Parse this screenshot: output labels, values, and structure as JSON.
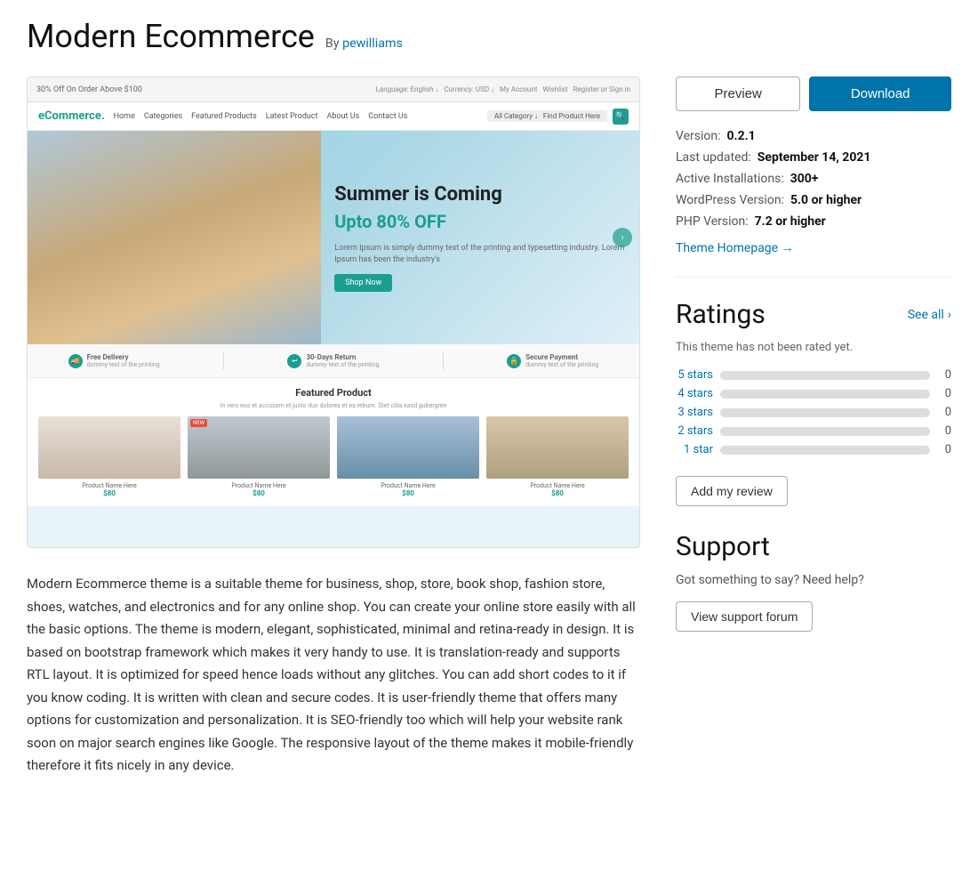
{
  "header": {
    "title": "Modern Ecommerce",
    "by_text": "By",
    "author": "pewilliams"
  },
  "screenshot_alt": "Modern Ecommerce theme screenshot",
  "fake_screenshot": {
    "topbar_text": "30% Off On Order Above $100",
    "logo": "eCommerce.",
    "nav_links": [
      "Home",
      "Categories",
      "Featured Products",
      "Latest Product",
      "About Us",
      "Contact Us"
    ],
    "hero_heading": "Summer is Coming",
    "hero_subheading": "Upto 80% OFF",
    "hero_body": "Lorem Ipsum is simply dummy text of the printing and typesetting industry. Lorem Ipsum has been the industry's",
    "shop_btn": "Shop Now",
    "features": [
      "Free Delivery",
      "30-Days Return",
      "Secure Payment"
    ],
    "featured_title": "Featured Product",
    "featured_sub": "In vero eos et accusam et justo duo dolores et ea rebum. Stet clita kasd gubergren",
    "products": [
      {
        "price": "$80"
      },
      {
        "price": "$80"
      },
      {
        "price": "$80"
      },
      {
        "price": "$80"
      }
    ]
  },
  "description": "Modern Ecommerce theme is a suitable theme for business, shop, store, book shop, fashion store, shoes, watches, and electronics and for any online shop. You can create your online store easily with all the basic options. The theme is modern, elegant, sophisticated, minimal and retina-ready in design. It is based on bootstrap framework which makes it very handy to use. It is translation-ready and supports RTL layout. It is optimized for speed hence loads without any glitches. You can add short codes to it if you know coding. It is written with clean and secure codes. It is user-friendly theme that offers many options for customization and personalization. It is SEO-friendly too which will help your website rank soon on major search engines like Google. The responsive layout of the theme makes it mobile-friendly therefore it fits nicely in any device.",
  "sidebar": {
    "preview_label": "Preview",
    "download_label": "Download",
    "meta": {
      "version_label": "Version:",
      "version_value": "0.2.1",
      "last_updated_label": "Last updated:",
      "last_updated_value": "September 14, 2021",
      "active_installs_label": "Active Installations:",
      "active_installs_value": "300+",
      "wp_version_label": "WordPress Version:",
      "wp_version_value": "5.0 or higher",
      "php_version_label": "PHP Version:",
      "php_version_value": "7.2 or higher",
      "homepage_link_text": "Theme Homepage →"
    },
    "ratings": {
      "title": "Ratings",
      "see_all": "See all",
      "see_all_chevron": "›",
      "not_rated_text": "This theme has not been rated yet.",
      "bars": [
        {
          "label": "5 stars",
          "count": "0",
          "fill": 0
        },
        {
          "label": "4 stars",
          "count": "0",
          "fill": 0
        },
        {
          "label": "3 stars",
          "count": "0",
          "fill": 0
        },
        {
          "label": "2 stars",
          "count": "0",
          "fill": 0
        },
        {
          "label": "1 star",
          "count": "0",
          "fill": 0
        }
      ],
      "add_review_label": "Add my review"
    },
    "support": {
      "title": "Support",
      "text": "Got something to say? Need help?",
      "forum_btn": "View support forum"
    }
  },
  "colors": {
    "accent": "#0073aa",
    "download_bg": "#0073aa",
    "teal": "#1a9e8f"
  }
}
